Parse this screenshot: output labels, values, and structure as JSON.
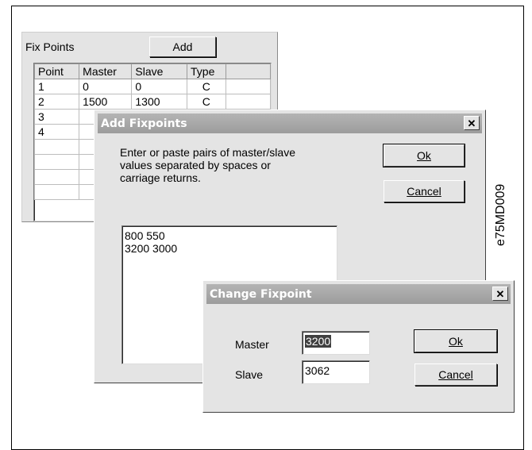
{
  "fix_points": {
    "label": "Fix Points",
    "add_label": "Add",
    "columns": [
      "Point",
      "Master",
      "Slave",
      "Type"
    ],
    "rows": [
      {
        "point": "1",
        "master": "0",
        "slave": "0",
        "type": "C"
      },
      {
        "point": "2",
        "master": "1500",
        "slave": "1300",
        "type": "C"
      },
      {
        "point": "3",
        "master": "",
        "slave": "",
        "type": ""
      },
      {
        "point": "4",
        "master": "",
        "slave": "",
        "type": ""
      }
    ]
  },
  "add_dialog": {
    "title": "Add Fixpoints",
    "instructions": "Enter or paste pairs of master/slave values separated by spaces or carriage returns.",
    "ok_label": "Ok",
    "cancel_label": "Cancel",
    "text_lines": [
      "800 550",
      "3200 3000"
    ]
  },
  "change_dialog": {
    "title": "Change Fixpoint",
    "master_label": "Master",
    "master_value": "3200",
    "slave_label": "Slave",
    "slave_value": "3062",
    "ok_label": "Ok",
    "cancel_label": "Cancel"
  },
  "figure_id": "e75MD009"
}
